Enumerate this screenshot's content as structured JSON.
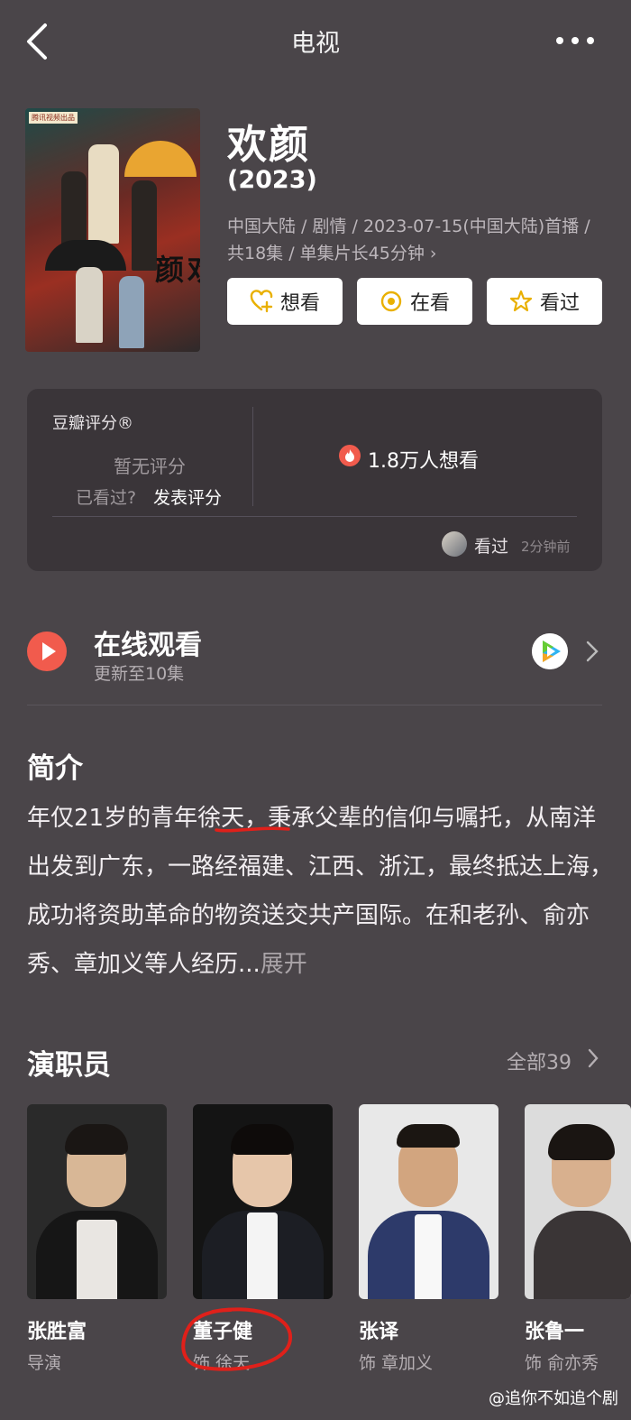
{
  "header": {
    "title": "电视"
  },
  "show": {
    "name": "欢颜",
    "year": "(2023)",
    "meta_line": "中国大陆 / 剧情 / 2023-07-15(中国大陆)首播 / 共18集 / 单集片长45分钟",
    "poster_chars": "欢颜",
    "poster_tag": "腾讯视频出品"
  },
  "actions": {
    "want": "想看",
    "watching": "在看",
    "watched": "看过"
  },
  "rating": {
    "label": "豆瓣评分®",
    "no_score": "暂无评分",
    "seen_question": "已看过?",
    "rate_link": "发表评分",
    "want_count": "1.8万人想看",
    "recent_action": "看过",
    "recent_time": "2分钟前"
  },
  "watch": {
    "title": "在线观看",
    "subtitle": "更新至10集"
  },
  "intro": {
    "heading": "简介",
    "text": "年仅21岁的青年徐天，秉承父辈的信仰与嘱托，从南洋出发到广东，一路经福建、江西、浙江，最终抵达上海，成功将资助革命的物资送交共产国际。在和老孙、俞亦秀、章加义等人经历...",
    "expand": "展开"
  },
  "cast": {
    "heading": "演职员",
    "all_label": "全部39",
    "members": [
      {
        "name": "张胜富",
        "role": "导演"
      },
      {
        "name": "董子健",
        "role": "饰 徐天"
      },
      {
        "name": "张译",
        "role": "饰 章加义"
      },
      {
        "name": "张鲁一",
        "role": "饰 俞亦秀"
      }
    ]
  },
  "watermark": "@追你不如追个剧",
  "colors": {
    "background": "#4a4549",
    "card": "#3a3539",
    "accent_red": "#f15b4d",
    "button_icon": "#e9b000"
  }
}
